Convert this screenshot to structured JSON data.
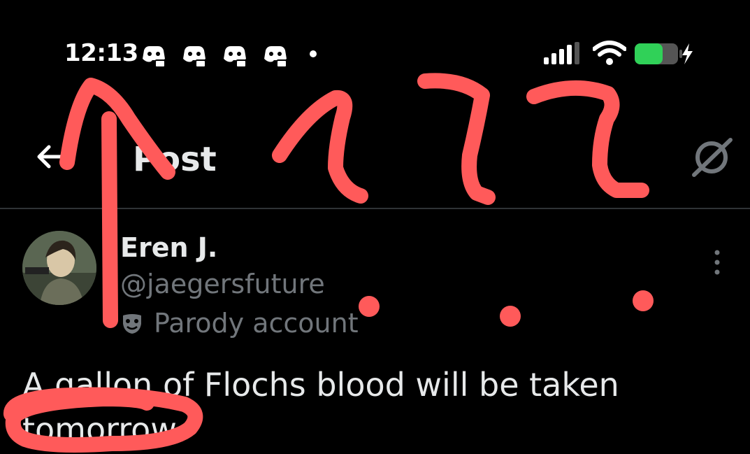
{
  "status_bar": {
    "time": "12:13",
    "notification_icons": [
      "discord-icon",
      "discord-icon",
      "discord-icon",
      "discord-icon"
    ],
    "battery_color": "#30d158"
  },
  "header": {
    "title": "Post",
    "back_icon": "arrow-left-icon",
    "grok_icon": "grok-icon"
  },
  "post": {
    "author_name": "Eren J.",
    "handle": "@jaegersfuture",
    "label": "Parody account",
    "text": "A gallon of Flochs blood will be taken tomorrow"
  },
  "annotation": {
    "color": "#ff5a5a",
    "drawn_text": "?????"
  },
  "colors": {
    "background": "#000000",
    "primary_text": "#e7e9ea",
    "secondary_text": "#71767b"
  }
}
